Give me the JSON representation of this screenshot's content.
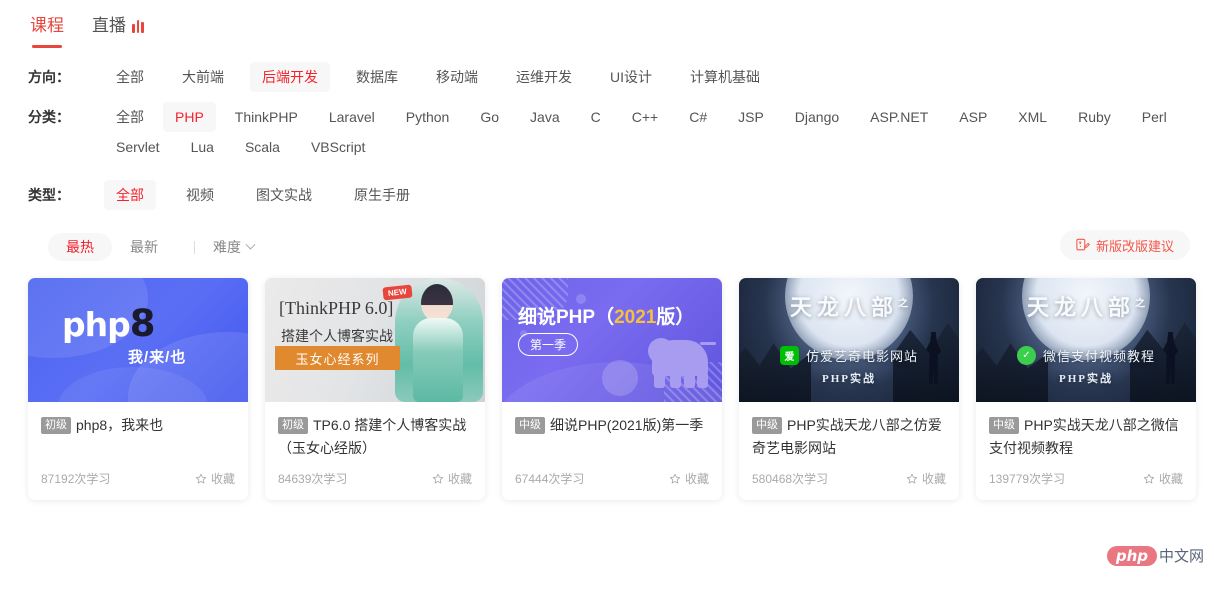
{
  "top_tabs": [
    {
      "label": "课程",
      "active": true,
      "live": false
    },
    {
      "label": "直播",
      "active": false,
      "live": true
    }
  ],
  "filters": [
    {
      "label": "方向：",
      "name": "direction",
      "options": [
        "全部",
        "大前端",
        "后端开发",
        "数据库",
        "移动端",
        "运维开发",
        "UI设计",
        "计算机基础"
      ],
      "selected": "后端开发"
    },
    {
      "label": "分类：",
      "name": "category",
      "options": [
        "全部",
        "PHP",
        "ThinkPHP",
        "Laravel",
        "Python",
        "Go",
        "Java",
        "C",
        "C++",
        "C#",
        "JSP",
        "Django",
        "ASP.NET",
        "ASP",
        "XML",
        "Ruby",
        "Perl",
        "Servlet",
        "Lua",
        "Scala",
        "VBScript"
      ],
      "selected": "PHP"
    },
    {
      "label": "类型：",
      "name": "type",
      "options": [
        "全部",
        "视频",
        "图文实战",
        "原生手册"
      ],
      "selected": "全部"
    }
  ],
  "sortbar": {
    "hottest": "最热",
    "newest": "最新",
    "difficulty": "难度",
    "selected": "最热",
    "suggest_label": "新版改版建议"
  },
  "colors": {
    "accent_red": "#f5222d",
    "tab_red": "#e8453c",
    "suggest_red": "#f5564a",
    "level_badge": "#9a9a9a",
    "chip_bg": "#f7f7f7"
  },
  "cards": [
    {
      "art": "php8",
      "level": "初级",
      "title": "php8，我来也",
      "learn_count": "87192次学习",
      "fav_label": "收藏",
      "cover_text": {
        "main": "php",
        "accent": "8",
        "sub": "我/来/也"
      }
    },
    {
      "art": "thinkphp",
      "level": "初级",
      "title": "TP6.0 搭建个人博客实战（玉女心经版）",
      "learn_count": "84639次学习",
      "fav_label": "收藏",
      "cover_text": {
        "line1": "[ThinkPHP 6.0]",
        "line2": "搭建个人博客实战",
        "ribbon": "玉女心经系列",
        "badge": "NEW"
      }
    },
    {
      "art": "xishuo",
      "level": "中级",
      "title": "细说PHP(2021版)第一季",
      "learn_count": "67444次学习",
      "fav_label": "收藏",
      "cover_text": {
        "main": "细说PHP（",
        "accent": "2021",
        "tail": "版）",
        "pill": "第一季"
      }
    },
    {
      "art": "tianlong-iqiyi",
      "level": "中级",
      "title": "PHP实战天龙八部之仿爱奇艺电影网站",
      "learn_count": "580468次学习",
      "fav_label": "收藏",
      "cover_text": {
        "title": "天龙八部",
        "sup": "之",
        "mid": "仿爱艺奇电影网站",
        "sub": "PHP实战",
        "mark": "爱"
      }
    },
    {
      "art": "tianlong-wechat",
      "level": "中级",
      "title": "PHP实战天龙八部之微信支付视频教程",
      "learn_count": "139779次学习",
      "fav_label": "收藏",
      "cover_text": {
        "title": "天龙八部",
        "sup": "之",
        "mid": "微信支付视频教程",
        "sub": "PHP实战",
        "mark": "✓"
      }
    }
  ],
  "watermark": {
    "php": "php",
    "cn": "中文网"
  }
}
